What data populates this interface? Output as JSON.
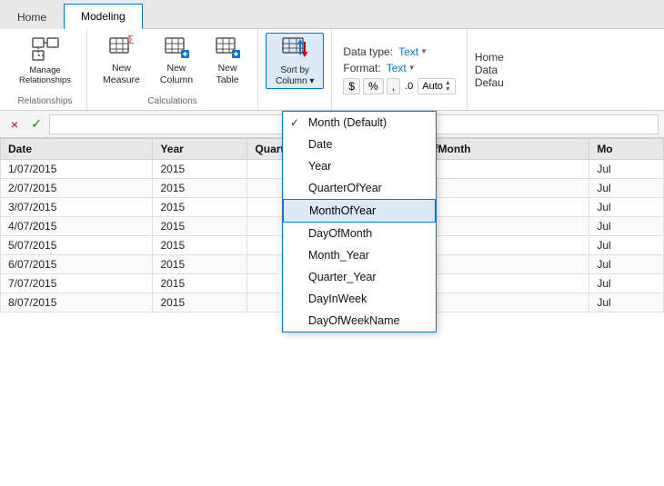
{
  "tabs": [
    {
      "id": "home",
      "label": "Home",
      "active": false
    },
    {
      "id": "modeling",
      "label": "Modeling",
      "active": true
    }
  ],
  "ribbon": {
    "groups": [
      {
        "id": "relationships",
        "label": "Relationships",
        "buttons": [
          {
            "id": "manage-relationships",
            "label": "Manage\nRelationships",
            "icon": "table-link"
          }
        ]
      },
      {
        "id": "calculations",
        "label": "Calculations",
        "buttons": [
          {
            "id": "new-measure",
            "label": "New\nMeasure",
            "icon": "calc"
          },
          {
            "id": "new-column",
            "label": "New\nColumn",
            "icon": "col"
          },
          {
            "id": "new-table",
            "label": "New\nTable",
            "icon": "table"
          }
        ]
      }
    ],
    "sort_by_column": {
      "label": "Sort by\nColumn",
      "active": true
    },
    "properties": {
      "data_type_label": "Data type:",
      "data_type_value": "Text",
      "format_label": "Format:",
      "format_value": "Text",
      "home_label": "Home",
      "data_label": "Data",
      "default_label": "Defau"
    }
  },
  "dropdown": {
    "items": [
      {
        "id": "month-default",
        "label": "Month (Default)",
        "checked": true,
        "highlighted": false
      },
      {
        "id": "date",
        "label": "Date",
        "checked": false,
        "highlighted": false
      },
      {
        "id": "year",
        "label": "Year",
        "checked": false,
        "highlighted": false
      },
      {
        "id": "quarterofyear",
        "label": "QuarterOfYear",
        "checked": false,
        "highlighted": false
      },
      {
        "id": "monthofyear",
        "label": "MonthOfYear",
        "checked": false,
        "highlighted": true
      },
      {
        "id": "dayofmonth",
        "label": "DayOfMonth",
        "checked": false,
        "highlighted": false
      },
      {
        "id": "month-year",
        "label": "Month_Year",
        "checked": false,
        "highlighted": false
      },
      {
        "id": "quarter-year",
        "label": "Quarter_Year",
        "checked": false,
        "highlighted": false
      },
      {
        "id": "dayinweek",
        "label": "DayInWeek",
        "checked": false,
        "highlighted": false
      },
      {
        "id": "dayofweekname",
        "label": "DayOfWeekName",
        "checked": false,
        "highlighted": false
      }
    ]
  },
  "formula_bar": {
    "close_label": "×",
    "check_label": "✓"
  },
  "grid": {
    "columns": [
      "Date",
      "Year",
      "QuarterO",
      "DayOfMonth",
      "Mo"
    ],
    "rows": [
      {
        "date": "1/07/2015",
        "year": "2015",
        "quarter": "",
        "dayofmonth": "1",
        "mo": "Jul"
      },
      {
        "date": "2/07/2015",
        "year": "2015",
        "quarter": "",
        "dayofmonth": "2",
        "mo": "Jul"
      },
      {
        "date": "3/07/2015",
        "year": "2015",
        "quarter": "",
        "dayofmonth": "3",
        "mo": "Jul"
      },
      {
        "date": "4/07/2015",
        "year": "2015",
        "quarter": "",
        "dayofmonth": "4",
        "mo": "Jul"
      },
      {
        "date": "5/07/2015",
        "year": "2015",
        "quarter": "",
        "dayofmonth": "5",
        "mo": "Jul"
      },
      {
        "date": "6/07/2015",
        "year": "2015",
        "quarter": "",
        "dayofmonth": "6",
        "mo": "Jul"
      },
      {
        "date": "7/07/2015",
        "year": "2015",
        "quarter": "",
        "dayofmonth": "7",
        "mo": "Jul"
      },
      {
        "date": "8/07/2015",
        "year": "2015",
        "quarter": "",
        "dayofmonth": "8",
        "mo": "Jul"
      }
    ]
  }
}
